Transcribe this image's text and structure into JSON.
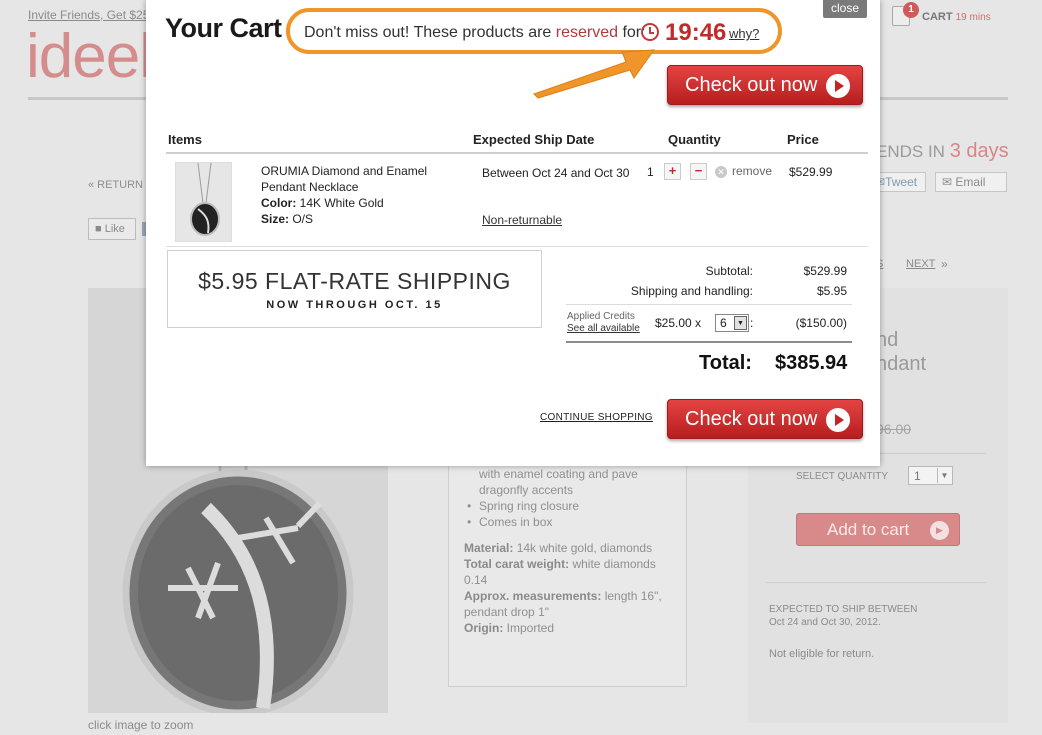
{
  "background": {
    "invite_text": "Invite Friends, Get $25",
    "logo": "ideel",
    "header_cart": {
      "count": "1",
      "label": "CART",
      "timer": "19 mins"
    },
    "sale_ends": {
      "prefix": "ENDS IN",
      "value": "3 days"
    },
    "return_link": "« RETURN T",
    "share": {
      "tweet": "Tweet",
      "email": "Email",
      "like": "Like"
    },
    "pager": {
      "prev_fragment": "S",
      "next": "NEXT",
      "arrow": "»"
    },
    "zoom_caption": "click image to zoom",
    "description": {
      "fragment": "with enamel coating and pave dragonfly accents",
      "bullets": [
        "Spring ring closure",
        "Comes in box"
      ],
      "specs": [
        {
          "k": "Material:",
          "v": " 14k white gold, diamonds"
        },
        {
          "k": "Total carat weight:",
          "v": " white diamonds 0.14"
        },
        {
          "k": "Approx. measurements:",
          "v": " length 16\", pendant drop 1\""
        },
        {
          "k": "Origin:",
          "v": " Imported"
        }
      ]
    },
    "side": {
      "title_line1": "nd",
      "title_line2": "ndant",
      "old_price": "96.00",
      "select_quantity_label": "SELECT QUANTITY",
      "quantity_value": "1",
      "add_to_cart": "Add to cart",
      "expected_ship_line1": "EXPECTED TO SHIP BETWEEN",
      "expected_ship_line2": "Oct 24 and Oct 30, 2012.",
      "not_eligible": "Not eligible for return."
    }
  },
  "modal": {
    "close": "close",
    "title": "Your Cart",
    "reserve": {
      "prefix": "Don't miss out! These products are ",
      "highlight": "reserved",
      "suffix": " for:",
      "timer": "19:46",
      "why": "why?"
    },
    "checkout_label": "Check out now",
    "headers": {
      "items": "Items",
      "ship": "Expected Ship Date",
      "quantity": "Quantity",
      "price": "Price"
    },
    "item": {
      "name": "ORUMIA Diamond and Enamel Pendant Necklace",
      "color_label": "Color:",
      "color": " 14K White Gold",
      "size_label": "Size:",
      "size": " O/S",
      "ship_dates": "Between Oct 24 and Oct 30",
      "non_returnable": "Non-returnable",
      "quantity": "1",
      "plus": "+",
      "minus": "−",
      "remove": "remove",
      "price": "$529.99"
    },
    "promo": {
      "line1": "$5.95 FLAT-RATE SHIPPING",
      "line2": "NOW THROUGH OCT. 15"
    },
    "summary": {
      "subtotal_label": "Subtotal:",
      "subtotal": "$529.99",
      "shipping_label": "Shipping and handling:",
      "shipping": "$5.95",
      "credits_label": "Applied Credits",
      "credits_link": "See all available",
      "credit_amount": "$25.00 x",
      "credit_count": "6",
      "credit_total": "($150.00)",
      "total_label": "Total:",
      "total": "$385.94"
    },
    "continue_shopping": "CONTINUE SHOPPING"
  },
  "colors": {
    "accent_orange": "#f0952a",
    "checkout_red": "#d32f2f",
    "timer_red": "#c22b2b",
    "logo_pink": "#d48d8c"
  }
}
